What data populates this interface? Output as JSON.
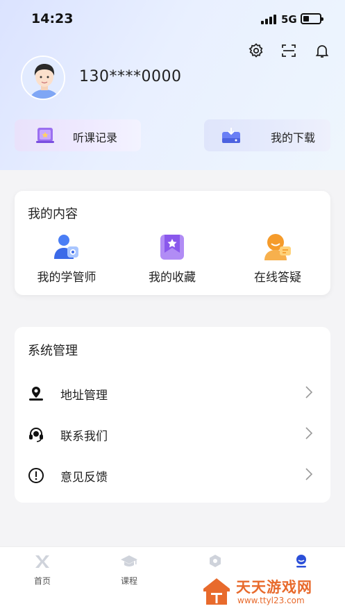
{
  "status_bar": {
    "time": "14:23",
    "network": "5G"
  },
  "header": {
    "phone": "130****0000",
    "icons": [
      "gear-icon",
      "scan-icon",
      "bell-icon"
    ]
  },
  "quick_actions": [
    {
      "label": "听课记录",
      "icon": "book-icon"
    },
    {
      "label": "我的下载",
      "icon": "download-box-icon"
    }
  ],
  "content_section": {
    "title": "我的内容",
    "items": [
      {
        "label": "我的学管师",
        "icon": "teacher-icon"
      },
      {
        "label": "我的收藏",
        "icon": "star-bookmark-icon"
      },
      {
        "label": "在线答疑",
        "icon": "chat-person-icon"
      }
    ]
  },
  "system_section": {
    "title": "系统管理",
    "items": [
      {
        "label": "地址管理",
        "icon": "location-person-icon"
      },
      {
        "label": "联系我们",
        "icon": "headset-icon"
      },
      {
        "label": "意见反馈",
        "icon": "alert-circle-icon"
      }
    ]
  },
  "tabbar": [
    {
      "label": "首页",
      "icon": "home-logo-icon"
    },
    {
      "label": "课程",
      "icon": "graduation-cap-icon"
    },
    {
      "label": "",
      "icon": "hexagon-icon"
    },
    {
      "label": "",
      "icon": "user-icon"
    }
  ],
  "colors": {
    "accent": "#3b5bdb",
    "purple": "#9b6ff0",
    "orange": "#f59b2b",
    "watermark": "#e86a2c"
  },
  "watermark": {
    "title": "天天游戏网",
    "url": "www.ttyl23.com"
  }
}
